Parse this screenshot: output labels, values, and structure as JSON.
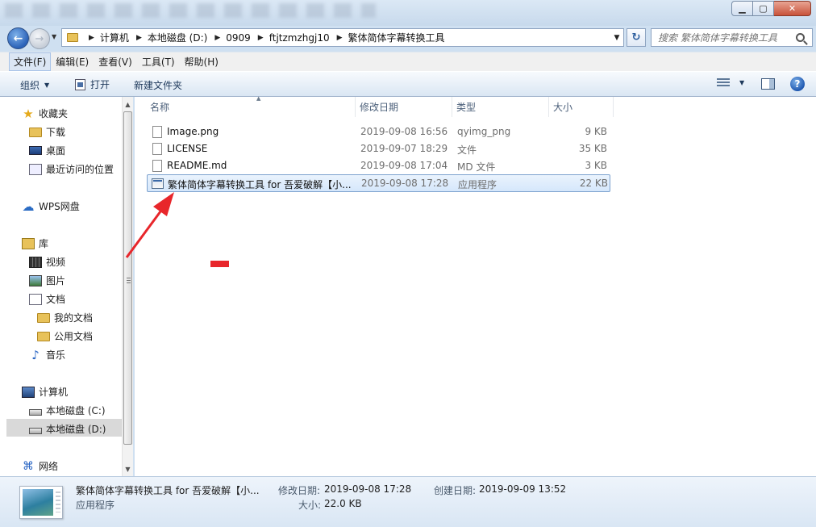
{
  "window": {
    "min_label": "▁",
    "max_label": "▢",
    "close_label": "✕"
  },
  "address": {
    "crumbs": [
      "计算机",
      "本地磁盘 (D:)",
      "0909",
      "ftjtzmzhgj10",
      "繁体简体字幕转换工具"
    ]
  },
  "search": {
    "placeholder": "搜索 繁体简体字幕转换工具"
  },
  "menu": {
    "items": [
      "文件(F)",
      "编辑(E)",
      "查看(V)",
      "工具(T)",
      "帮助(H)"
    ]
  },
  "toolbar": {
    "organize_label": "组织",
    "open_label": "打开",
    "new_folder_label": "新建文件夹"
  },
  "nav": {
    "favorites": "收藏夹",
    "downloads": "下载",
    "desktop": "桌面",
    "recent": "最近访问的位置",
    "wps": "WPS网盘",
    "libraries": "库",
    "videos": "视频",
    "pictures": "图片",
    "documents": "文档",
    "my_documents": "我的文档",
    "public_documents": "公用文档",
    "music": "音乐",
    "computer": "计算机",
    "drive_c": "本地磁盘 (C:)",
    "drive_d": "本地磁盘 (D:)",
    "network": "网络"
  },
  "columns": {
    "name": "名称",
    "date": "修改日期",
    "type": "类型",
    "size": "大小"
  },
  "files": [
    {
      "name": "Image.png",
      "date": "2019-09-08 16:56",
      "type": "qyimg_png",
      "size": "9 KB"
    },
    {
      "name": "LICENSE",
      "date": "2019-09-07 18:29",
      "type": "文件",
      "size": "35 KB"
    },
    {
      "name": "README.md",
      "date": "2019-09-08 17:04",
      "type": "MD 文件",
      "size": "3 KB"
    },
    {
      "name": "繁体简体字幕转换工具 for 吾爱破解【小...",
      "date": "2019-09-08 17:28",
      "type": "应用程序",
      "size": "22 KB"
    }
  ],
  "details": {
    "name": "繁体简体字幕转换工具 for 吾爱破解【小...",
    "type": "应用程序",
    "modified_label": "修改日期:",
    "modified_value": "2019-09-08 17:28",
    "created_label": "创建日期:",
    "created_value": "2019-09-09 13:52",
    "size_label": "大小:",
    "size_value": "22.0 KB"
  },
  "colors": {
    "annotation_red": "#e8262b",
    "selection_border": "#7da2ce"
  }
}
